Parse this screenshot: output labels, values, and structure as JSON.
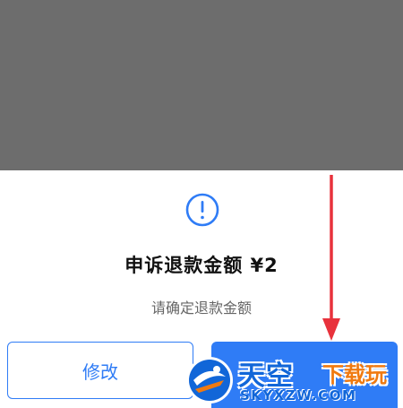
{
  "dialog": {
    "title": "申诉退款金额 ¥2",
    "subtitle": "请确定退款金额",
    "modify_label": "修改",
    "confirm_label": ""
  },
  "watermark": {
    "main": "天空",
    "accent": "下载玩",
    "url": "SKYXZW.COM"
  },
  "icons": {
    "alert": "exclamation-circle-icon",
    "arrow": "red-down-arrow-annotation"
  },
  "colors": {
    "accent": "#2f7cf6",
    "overlay": "#6d6d6d",
    "arrow": "#e8323c",
    "watermark_blue": "#1166d8",
    "watermark_orange": "#f07a10"
  }
}
